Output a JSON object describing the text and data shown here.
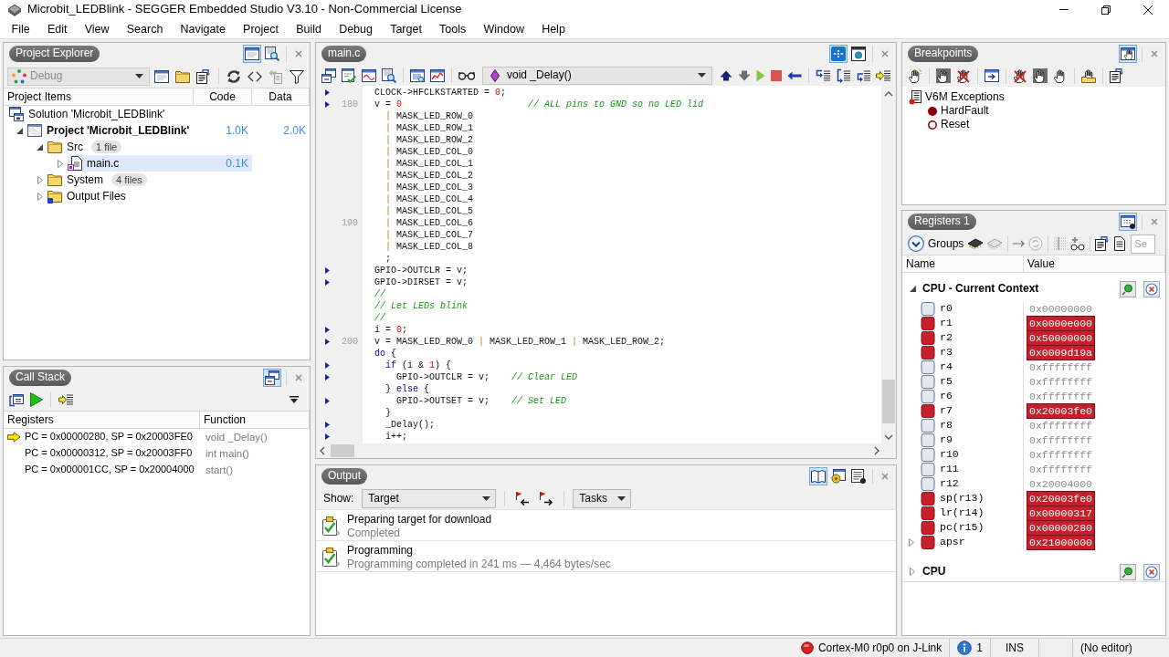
{
  "window": {
    "title": "Microbit_LEDBlink - SEGGER Embedded Studio V3.10 - Non-Commercial License"
  },
  "menu": [
    "File",
    "Edit",
    "View",
    "Search",
    "Navigate",
    "Project",
    "Build",
    "Debug",
    "Target",
    "Tools",
    "Window",
    "Help"
  ],
  "project_explorer": {
    "title": "Project Explorer",
    "header_buttons": [
      {
        "pressed": true
      },
      {
        "pressed": false
      }
    ],
    "configuration": {
      "value": "Debug",
      "disabled": true
    },
    "columns": [
      "Project Items",
      "Code",
      "Data"
    ],
    "tree": [
      {
        "kind": "solution",
        "label": "Solution 'Microbit_LEDBlink'",
        "selected": false,
        "children": [
          {
            "kind": "project",
            "label": "Project 'Microbit_LEDBlink'",
            "code": "1.0K",
            "data": "2.0K",
            "expanded": true,
            "selected": false,
            "children": [
              {
                "kind": "folder",
                "label": "Src",
                "badge": "1 file",
                "expanded": true,
                "selected": false,
                "children": [
                  {
                    "kind": "file",
                    "label": "main.c",
                    "code": "0.1K",
                    "expanded": false,
                    "selected": true
                  }
                ]
              },
              {
                "kind": "folder",
                "label": "System",
                "badge": "4 files",
                "expanded": false,
                "selected": false
              },
              {
                "kind": "output",
                "label": "Output Files",
                "expanded": false,
                "selected": false
              }
            ]
          }
        ]
      }
    ]
  },
  "call_stack": {
    "title": "Call Stack",
    "header_buttons": [
      {
        "pressed": true
      }
    ],
    "columns": [
      "Registers",
      "Function"
    ],
    "frames": [
      {
        "registers": "PC = 0x00000280, SP = 0x20003FE0",
        "function": "void _Delay()",
        "current": true
      },
      {
        "registers": "PC = 0x00000312, SP = 0x20003FF0",
        "function": "int main()",
        "current": false
      },
      {
        "registers": "PC = 0x000001CC, SP = 0x20004000",
        "function": "start()",
        "current": false
      }
    ]
  },
  "editor": {
    "tab": "main.c",
    "header_buttons": [
      {
        "pressed": true
      },
      {
        "pressed": false
      }
    ],
    "function": "void _Delay()",
    "lines": [
      {
        "marker": true,
        "tokens": [
          {
            "kind": "text",
            "text": "CLOCK->HFCLKSTARTED = "
          },
          {
            "kind": "number",
            "text": "0"
          },
          {
            "kind": "text",
            "text": ";"
          }
        ]
      },
      {
        "number": "180",
        "marker": true,
        "tokens": [
          {
            "kind": "text",
            "text": "v = "
          },
          {
            "kind": "number",
            "text": "0"
          },
          {
            "kind": "comment",
            "text": "                       // ALL pins to GND so no LED lid"
          }
        ]
      },
      {
        "marker": false,
        "tokens": [
          {
            "kind": "operator",
            "text": "  |"
          },
          {
            "kind": "text",
            "text": " MASK_LED_ROW_0"
          }
        ]
      },
      {
        "marker": false,
        "tokens": [
          {
            "kind": "operator",
            "text": "  |"
          },
          {
            "kind": "text",
            "text": " MASK_LED_ROW_1"
          }
        ]
      },
      {
        "marker": false,
        "tokens": [
          {
            "kind": "operator",
            "text": "  |"
          },
          {
            "kind": "text",
            "text": " MASK_LED_ROW_2"
          }
        ]
      },
      {
        "marker": false,
        "tokens": [
          {
            "kind": "operator",
            "text": "  |"
          },
          {
            "kind": "text",
            "text": " MASK_LED_COL_0"
          }
        ]
      },
      {
        "marker": false,
        "tokens": [
          {
            "kind": "operator",
            "text": "  |"
          },
          {
            "kind": "text",
            "text": " MASK_LED_COL_1"
          }
        ]
      },
      {
        "marker": false,
        "tokens": [
          {
            "kind": "operator",
            "text": "  |"
          },
          {
            "kind": "text",
            "text": " MASK_LED_COL_2"
          }
        ]
      },
      {
        "marker": false,
        "tokens": [
          {
            "kind": "operator",
            "text": "  |"
          },
          {
            "kind": "text",
            "text": " MASK_LED_COL_3"
          }
        ]
      },
      {
        "marker": false,
        "tokens": [
          {
            "kind": "operator",
            "text": "  |"
          },
          {
            "kind": "text",
            "text": " MASK_LED_COL_4"
          }
        ]
      },
      {
        "marker": false,
        "tokens": [
          {
            "kind": "operator",
            "text": "  |"
          },
          {
            "kind": "text",
            "text": " MASK_LED_COL_5"
          }
        ]
      },
      {
        "number": "190",
        "marker": false,
        "tokens": [
          {
            "kind": "operator",
            "text": "  |"
          },
          {
            "kind": "text",
            "text": " MASK_LED_COL_6"
          }
        ]
      },
      {
        "marker": false,
        "tokens": [
          {
            "kind": "operator",
            "text": "  |"
          },
          {
            "kind": "text",
            "text": " MASK_LED_COL_7"
          }
        ]
      },
      {
        "marker": false,
        "tokens": [
          {
            "kind": "operator",
            "text": "  |"
          },
          {
            "kind": "text",
            "text": " MASK_LED_COL_8"
          }
        ]
      },
      {
        "marker": false,
        "tokens": [
          {
            "kind": "text",
            "text": "  ;"
          }
        ]
      },
      {
        "marker": true,
        "tokens": [
          {
            "kind": "text",
            "text": "GPIO->OUTCLR = v;"
          }
        ]
      },
      {
        "marker": true,
        "tokens": [
          {
            "kind": "text",
            "text": "GPIO->DIRSET = v;"
          }
        ]
      },
      {
        "marker": false,
        "tokens": [
          {
            "kind": "comment",
            "text": "//"
          }
        ]
      },
      {
        "marker": false,
        "tokens": [
          {
            "kind": "comment",
            "text": "// Let LEDs blink"
          }
        ]
      },
      {
        "marker": false,
        "tokens": [
          {
            "kind": "comment",
            "text": "//"
          }
        ]
      },
      {
        "marker": true,
        "tokens": [
          {
            "kind": "text",
            "text": "i = "
          },
          {
            "kind": "number",
            "text": "0"
          },
          {
            "kind": "text",
            "text": ";"
          }
        ]
      },
      {
        "number": "200",
        "marker": true,
        "tokens": [
          {
            "kind": "text",
            "text": "v = MASK_LED_ROW_0 "
          },
          {
            "kind": "operator",
            "text": "|"
          },
          {
            "kind": "text",
            "text": " MASK_LED_ROW_1 "
          },
          {
            "kind": "operator",
            "text": "|"
          },
          {
            "kind": "text",
            "text": " MASK_LED_ROW_2;"
          }
        ]
      },
      {
        "marker": false,
        "tokens": [
          {
            "kind": "keyword",
            "text": "do"
          },
          {
            "kind": "text",
            "text": " {"
          }
        ]
      },
      {
        "marker": true,
        "tokens": [
          {
            "kind": "keyword",
            "text": "  if"
          },
          {
            "kind": "text",
            "text": " (i & "
          },
          {
            "kind": "number",
            "text": "1"
          },
          {
            "kind": "text",
            "text": ") {"
          }
        ]
      },
      {
        "marker": true,
        "tokens": [
          {
            "kind": "text",
            "text": "    GPIO->OUTCLR = v;"
          },
          {
            "kind": "comment",
            "text": "    // Clear LED"
          }
        ]
      },
      {
        "marker": false,
        "tokens": [
          {
            "kind": "text",
            "text": "  } "
          },
          {
            "kind": "keyword",
            "text": "else"
          },
          {
            "kind": "text",
            "text": " {"
          }
        ]
      },
      {
        "marker": true,
        "tokens": [
          {
            "kind": "text",
            "text": "    GPIO->OUTSET = v;"
          },
          {
            "kind": "comment",
            "text": "    // Set LED"
          }
        ]
      },
      {
        "marker": false,
        "tokens": [
          {
            "kind": "text",
            "text": "  }"
          }
        ]
      },
      {
        "marker": true,
        "tokens": [
          {
            "kind": "text",
            "text": "  _Delay();"
          }
        ]
      },
      {
        "marker": true,
        "tokens": [
          {
            "kind": "text",
            "text": "  i++;"
          }
        ]
      }
    ]
  },
  "output": {
    "title": "Output",
    "header_buttons": [
      {
        "pressed": true
      },
      {
        "pressed": false
      },
      {
        "pressed": false
      }
    ],
    "show_label": "Show:",
    "show": "Target",
    "filter": "Tasks",
    "messages": [
      {
        "title": "Preparing target for download",
        "detail": "Completed"
      },
      {
        "title": "Programming",
        "detail": "Programming completed in 241 ms — 4,464 bytes/sec"
      }
    ]
  },
  "breakpoints": {
    "title": "Breakpoints",
    "header_buttons": [
      {
        "pressed": true
      }
    ],
    "groups": [
      {
        "label": "V6M Exceptions",
        "children": [
          {
            "label": "HardFault",
            "enabled": true
          },
          {
            "label": "Reset",
            "enabled": false
          }
        ]
      }
    ]
  },
  "registers": {
    "title": "Registers 1",
    "header_buttons": [
      {
        "pressed": true
      }
    ],
    "groups_button": "Groups",
    "search": {
      "placeholder": "Se"
    },
    "columns": [
      "Name",
      "Value"
    ],
    "groups": [
      {
        "label": "CPU - Current Context",
        "expanded": true,
        "registers": [
          {
            "name": "r0",
            "value": "0x00000000",
            "changed": false
          },
          {
            "name": "r1",
            "value": "0x0000e000",
            "changed": true
          },
          {
            "name": "r2",
            "value": "0x50000000",
            "changed": true
          },
          {
            "name": "r3",
            "value": "0x0009d19a",
            "changed": true
          },
          {
            "name": "r4",
            "value": "0xffffffff",
            "changed": false
          },
          {
            "name": "r5",
            "value": "0xffffffff",
            "changed": false
          },
          {
            "name": "r6",
            "value": "0xffffffff",
            "changed": false
          },
          {
            "name": "r7",
            "value": "0x20003fe0",
            "changed": true
          },
          {
            "name": "r8",
            "value": "0xffffffff",
            "changed": false
          },
          {
            "name": "r9",
            "value": "0xffffffff",
            "changed": false
          },
          {
            "name": "r10",
            "value": "0xffffffff",
            "changed": false
          },
          {
            "name": "r11",
            "value": "0xffffffff",
            "changed": false
          },
          {
            "name": "r12",
            "value": "0x20004000",
            "changed": false
          },
          {
            "name": "sp(r13)",
            "value": "0x20003fe0",
            "changed": true
          },
          {
            "name": "lr(r14)",
            "value": "0x00000317",
            "changed": true
          },
          {
            "name": "pc(r15)",
            "value": "0x00000280",
            "changed": true
          },
          {
            "name": "apsr",
            "value": "0x21000000",
            "changed": true,
            "expanded": false
          }
        ]
      },
      {
        "label": "CPU",
        "expanded": false
      }
    ]
  },
  "status_bar": {
    "target": "Cortex-M0 r0p0 on J-Link",
    "messages": "1",
    "mode": "INS",
    "editor": "(No editor)"
  }
}
